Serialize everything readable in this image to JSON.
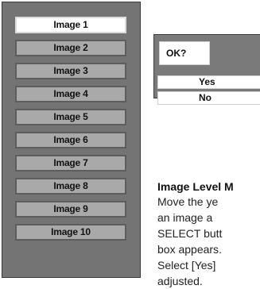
{
  "image_list": {
    "items": [
      {
        "label": "Image 1",
        "selected": true
      },
      {
        "label": "Image 2",
        "selected": false
      },
      {
        "label": "Image 3",
        "selected": false
      },
      {
        "label": "Image 4",
        "selected": false
      },
      {
        "label": "Image 5",
        "selected": false
      },
      {
        "label": "Image 6",
        "selected": false
      },
      {
        "label": "Image 7",
        "selected": false
      },
      {
        "label": "Image 8",
        "selected": false
      },
      {
        "label": "Image 9",
        "selected": false
      },
      {
        "label": "Image 10",
        "selected": false
      }
    ]
  },
  "dialog": {
    "title": "OK?",
    "yes_label": "Yes",
    "no_label": "No"
  },
  "text": {
    "heading": "Image Level M",
    "lines": [
      "Move the ye",
      "an image a",
      "SELECT butt",
      "box appears.",
      "Select [Yes]",
      "adjusted."
    ]
  }
}
